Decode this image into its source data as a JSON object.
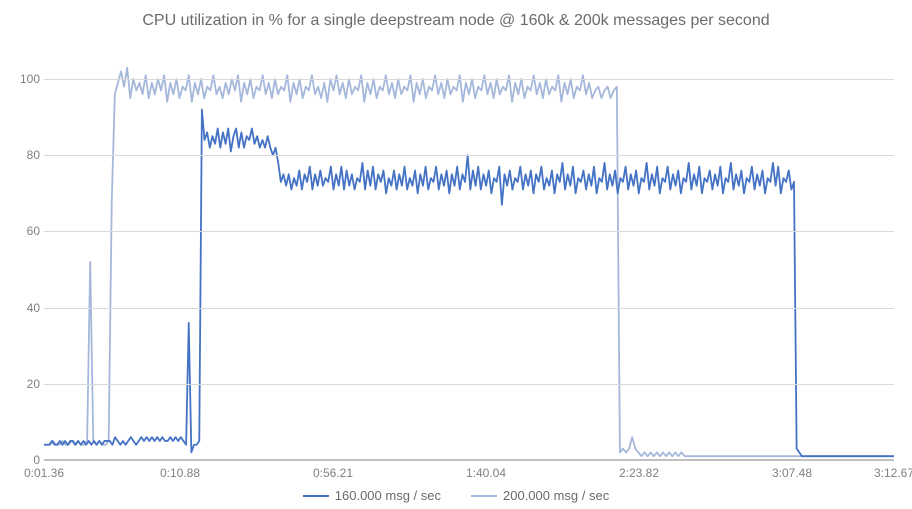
{
  "chart_data": {
    "type": "line",
    "title": "CPU utilization in % for a single deepstream node @ 160k & 200k messages per second",
    "xlabel": "",
    "ylabel": "",
    "ylim": [
      0,
      105
    ],
    "y_ticks": [
      0,
      20,
      40,
      60,
      80,
      100
    ],
    "x_tick_labels": [
      "0:01.36",
      "0:10.88",
      "0:56.21",
      "1:40.04",
      "2:23.82",
      "3:07.48",
      "3:12.67"
    ],
    "x_tick_positions": [
      0,
      0.16,
      0.34,
      0.52,
      0.7,
      0.88,
      1.0
    ],
    "colors": {
      "s160k": "#4472C4",
      "s200k": "#A5B8DB"
    },
    "legend": {
      "s160k": "160.000 msg / sec",
      "s200k": "200.000 msg / sec"
    },
    "series": [
      {
        "name": "160.000 msg / sec",
        "key": "s160k",
        "values": [
          4,
          4,
          4,
          5,
          4,
          4,
          5,
          4,
          5,
          4,
          5,
          5,
          4,
          5,
          4,
          5,
          4,
          5,
          4,
          5,
          4,
          5,
          4,
          5,
          5,
          5,
          4,
          6,
          5,
          4,
          5,
          4,
          5,
          6,
          5,
          4,
          5,
          6,
          5,
          6,
          5,
          6,
          5,
          6,
          5,
          6,
          5,
          5,
          6,
          5,
          6,
          5,
          6,
          5,
          4,
          36,
          2,
          4,
          4,
          5,
          92,
          84,
          86,
          82,
          85,
          83,
          87,
          82,
          86,
          83,
          87,
          81,
          85,
          87,
          82,
          86,
          82,
          85,
          84,
          87,
          83,
          85,
          82,
          84,
          82,
          85,
          82,
          80,
          82,
          78,
          73,
          75,
          72,
          75,
          71,
          74,
          72,
          76,
          71,
          75,
          73,
          77,
          71,
          75,
          72,
          76,
          72,
          74,
          73,
          77,
          71,
          75,
          72,
          77,
          71,
          76,
          72,
          75,
          71,
          74,
          73,
          78,
          71,
          76,
          72,
          77,
          71,
          75,
          73,
          76,
          70,
          74,
          72,
          76,
          71,
          75,
          72,
          77,
          71,
          74,
          72,
          76,
          70,
          75,
          72,
          77,
          71,
          74,
          73,
          77,
          71,
          75,
          72,
          76,
          70,
          75,
          72,
          77,
          71,
          75,
          73,
          80,
          71,
          76,
          72,
          77,
          71,
          75,
          72,
          76,
          70,
          74,
          73,
          77,
          67,
          75,
          72,
          76,
          71,
          74,
          73,
          77,
          71,
          75,
          72,
          76,
          70,
          75,
          73,
          77,
          71,
          74,
          72,
          76,
          70,
          75,
          73,
          78,
          71,
          75,
          72,
          77,
          70,
          74,
          73,
          76,
          71,
          75,
          72,
          77,
          70,
          74,
          73,
          78,
          71,
          75,
          72,
          76,
          70,
          74,
          73,
          77,
          71,
          75,
          72,
          76,
          70,
          74,
          73,
          78,
          71,
          75,
          72,
          77,
          70,
          74,
          73,
          77,
          71,
          75,
          72,
          76,
          70,
          74,
          73,
          78,
          71,
          75,
          72,
          77,
          70,
          74,
          73,
          76,
          71,
          75,
          72,
          77,
          70,
          74,
          73,
          78,
          71,
          75,
          72,
          76,
          70,
          74,
          73,
          77,
          71,
          75,
          72,
          76,
          70,
          74,
          73,
          78,
          72,
          77,
          70,
          74,
          73,
          76,
          71,
          73,
          3,
          2,
          1,
          1,
          1,
          1,
          1,
          1,
          1,
          1,
          1,
          1,
          1,
          1,
          1,
          1,
          1,
          1,
          1,
          1,
          1,
          1,
          1,
          1,
          1,
          1,
          1,
          1,
          1,
          1,
          1,
          1,
          1,
          1,
          1,
          1,
          1,
          1
        ]
      },
      {
        "name": "200.000 msg / sec",
        "key": "s200k",
        "values": [
          4,
          4,
          4,
          5,
          4,
          4,
          5,
          4,
          4,
          5,
          4,
          5,
          4,
          4,
          5,
          52,
          5,
          4,
          5,
          4,
          4,
          5,
          68,
          96,
          99,
          102,
          98,
          103,
          95,
          100,
          97,
          99,
          96,
          101,
          95,
          99,
          96,
          100,
          97,
          101,
          94,
          99,
          96,
          100,
          95,
          98,
          97,
          101,
          94,
          99,
          96,
          100,
          95,
          98,
          97,
          101,
          96,
          98,
          95,
          99,
          96,
          100,
          97,
          101,
          94,
          99,
          96,
          100,
          95,
          98,
          97,
          101,
          96,
          99,
          95,
          100,
          96,
          98,
          97,
          101,
          94,
          99,
          96,
          100,
          95,
          98,
          97,
          101,
          96,
          98,
          95,
          99,
          94,
          100,
          97,
          101,
          96,
          99,
          95,
          100,
          96,
          98,
          97,
          101,
          94,
          99,
          96,
          100,
          95,
          98,
          97,
          101,
          96,
          99,
          95,
          100,
          96,
          98,
          97,
          101,
          94,
          99,
          96,
          100,
          95,
          98,
          97,
          101,
          96,
          99,
          95,
          100,
          96,
          98,
          97,
          101,
          94,
          99,
          96,
          100,
          95,
          98,
          97,
          101,
          96,
          99,
          95,
          100,
          96,
          98,
          97,
          101,
          94,
          99,
          96,
          100,
          95,
          98,
          97,
          101,
          96,
          99,
          95,
          100,
          96,
          98,
          97,
          101,
          94,
          99,
          96,
          100,
          95,
          98,
          97,
          101,
          96,
          99,
          95,
          97,
          98,
          95,
          97,
          98,
          95,
          97,
          98,
          2,
          3,
          2,
          3,
          6,
          3,
          2,
          1,
          2,
          1,
          2,
          1,
          2,
          1,
          2,
          1,
          2,
          1,
          2,
          1,
          2,
          1,
          1,
          1,
          1,
          1,
          1,
          1,
          1,
          1,
          1,
          1,
          1,
          1,
          1,
          1,
          1,
          1,
          1,
          1,
          1,
          1,
          1,
          1,
          1,
          1,
          1,
          1,
          1,
          1,
          1,
          1,
          1,
          1,
          1,
          1,
          1,
          1,
          1,
          1,
          1,
          1,
          1,
          1,
          1,
          1,
          1,
          1,
          1,
          1,
          1,
          1,
          1,
          1,
          1,
          1,
          1,
          1,
          1,
          1,
          1,
          1,
          1,
          1,
          1,
          1,
          1,
          1,
          1,
          1
        ]
      }
    ]
  }
}
